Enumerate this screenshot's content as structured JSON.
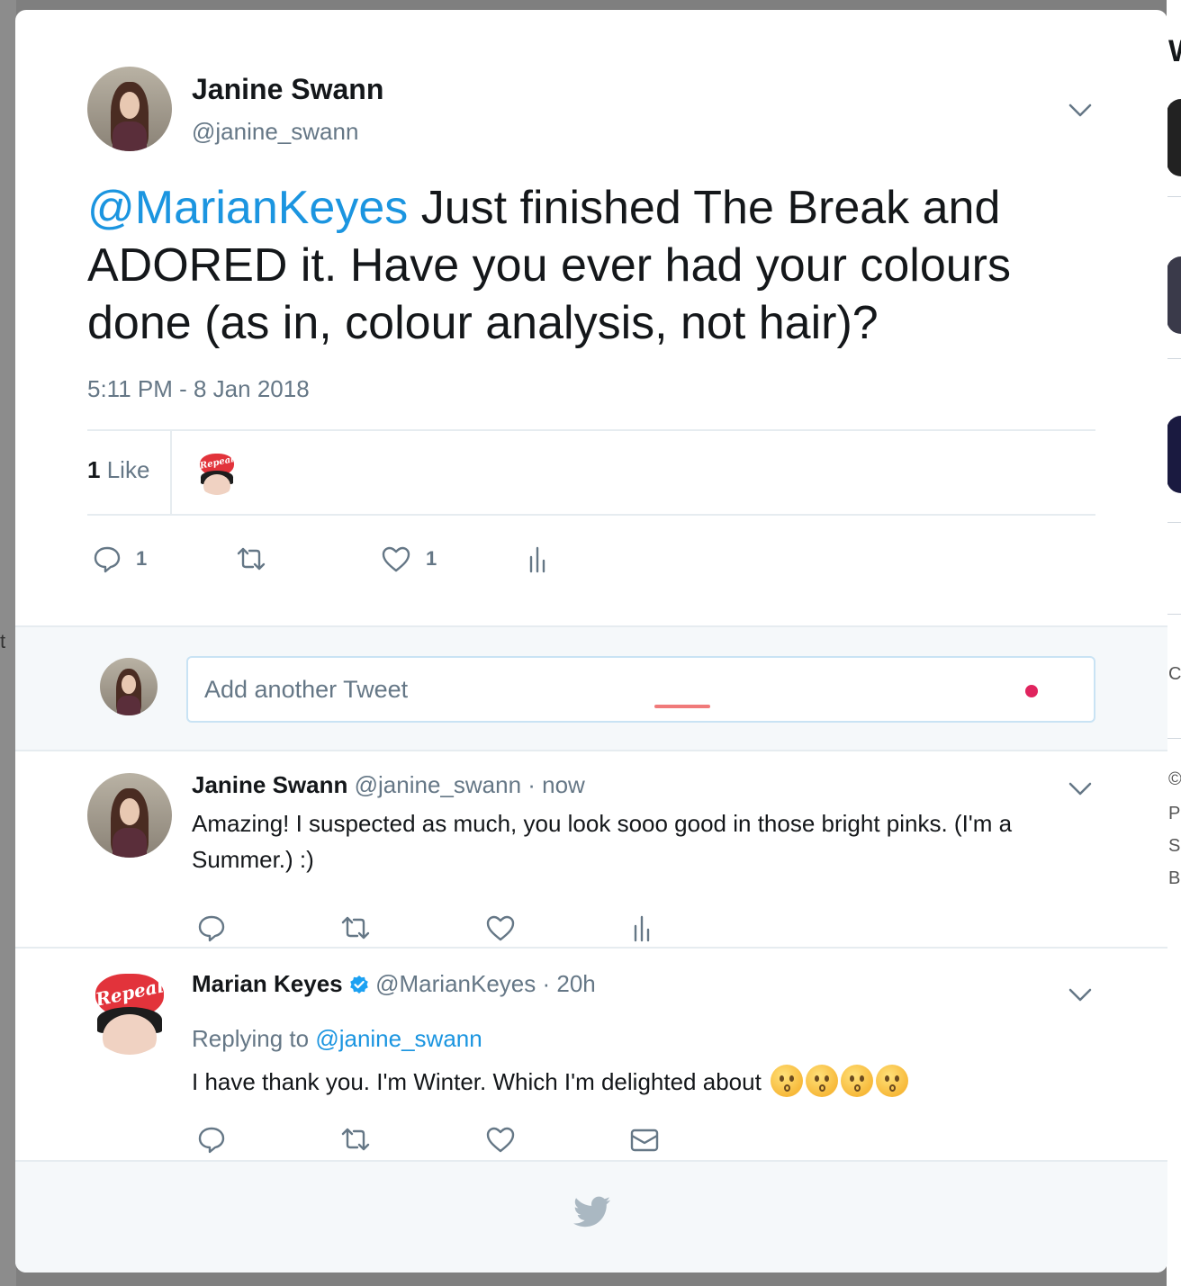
{
  "background": {
    "left_fragment": "t",
    "right_fragments": [
      "W",
      "C",
      "©",
      "P",
      "S",
      "B"
    ]
  },
  "tweet": {
    "author_name": "Janine Swann",
    "author_handle": "@janine_swann",
    "mention": "@MarianKeyes",
    "text": " Just finished The Break and ADORED it. Have you ever had your colours done (as in, colour analysis, not hair)?",
    "timestamp": "5:11 PM - 8 Jan 2018",
    "likes_count": "1",
    "likes_label": "Like",
    "reply_count": "1",
    "like_action_count": "1"
  },
  "compose": {
    "placeholder": "Add another Tweet"
  },
  "replies": [
    {
      "author_name": "Janine Swann",
      "author_handle": "@janine_swann",
      "time": " · now",
      "text": "Amazing! I suspected as much, you look sooo good in those bright pinks. (I'm a Summer.) :)"
    },
    {
      "author_name": "Marian Keyes",
      "author_handle": "@MarianKeyes",
      "time": " · 20h",
      "replying_prefix": "Replying to ",
      "replying_to": "@janine_swann",
      "text": "I have thank you. I'm Winter. Which I'm delighted about ",
      "verified": true
    }
  ],
  "avatar_badge_text": "Repeal",
  "colors": {
    "link": "#1b95e0",
    "muted": "#657786",
    "text": "#14171a",
    "divider": "#e6ecf0",
    "footer_bg": "#f5f8fa"
  },
  "icons": [
    "reply-icon",
    "retweet-icon",
    "like-icon",
    "analytics-icon",
    "direct-message-icon",
    "chevron-down-icon",
    "verified-icon",
    "twitter-bird-icon"
  ]
}
